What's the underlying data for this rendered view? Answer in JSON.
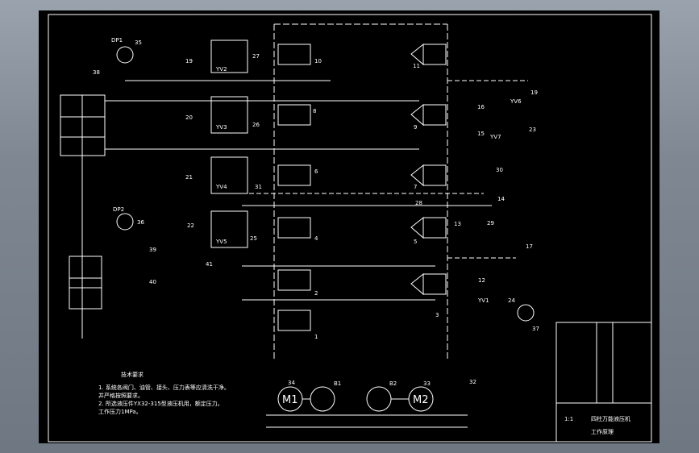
{
  "labels": {
    "n35": "35",
    "n38": "38",
    "n19a": "19",
    "n20": "20",
    "n21": "21",
    "n22": "22",
    "n36": "36",
    "n39": "39",
    "n40": "40",
    "n41": "41",
    "n10": "10",
    "n8": "8",
    "n6": "6",
    "n4": "4",
    "n2": "2",
    "n1": "1",
    "n27": "27",
    "n26": "26",
    "n31": "31",
    "n25": "25",
    "n28": "28",
    "n11": "11",
    "n9": "9",
    "n7": "7",
    "n5": "5",
    "n3": "3",
    "n19b": "19",
    "n16": "16",
    "n15": "15",
    "n23": "23",
    "n30": "30",
    "n14": "14",
    "n13": "13",
    "n29": "29",
    "n17": "17",
    "n12": "12",
    "n24": "24",
    "n37": "37",
    "n34": "34",
    "n33": "33",
    "n32": "32",
    "yv2": "YV2",
    "yv3": "YV3",
    "yv4": "YV4",
    "yv5": "YV5",
    "yv6": "YV6",
    "yv7": "YV7",
    "yv1": "YV1",
    "dp1": "DP1",
    "dp2": "DP2",
    "m1": "M1",
    "m2": "M2",
    "b1": "B1",
    "b2": "B2"
  },
  "notes": {
    "title": "技术要求",
    "line1": "1. 系统各阀门、油管、接头、压力表等应清洗干净。",
    "line2": "   并严格按照要求。",
    "line3": "2. 所选液压件YX32-315型液压机用，额定压力。",
    "line4": "   工作压力1MPa。"
  },
  "titleblock": {
    "name": "四柱万能液压机",
    "drawing": "工作原理",
    "unit": "1:1"
  }
}
